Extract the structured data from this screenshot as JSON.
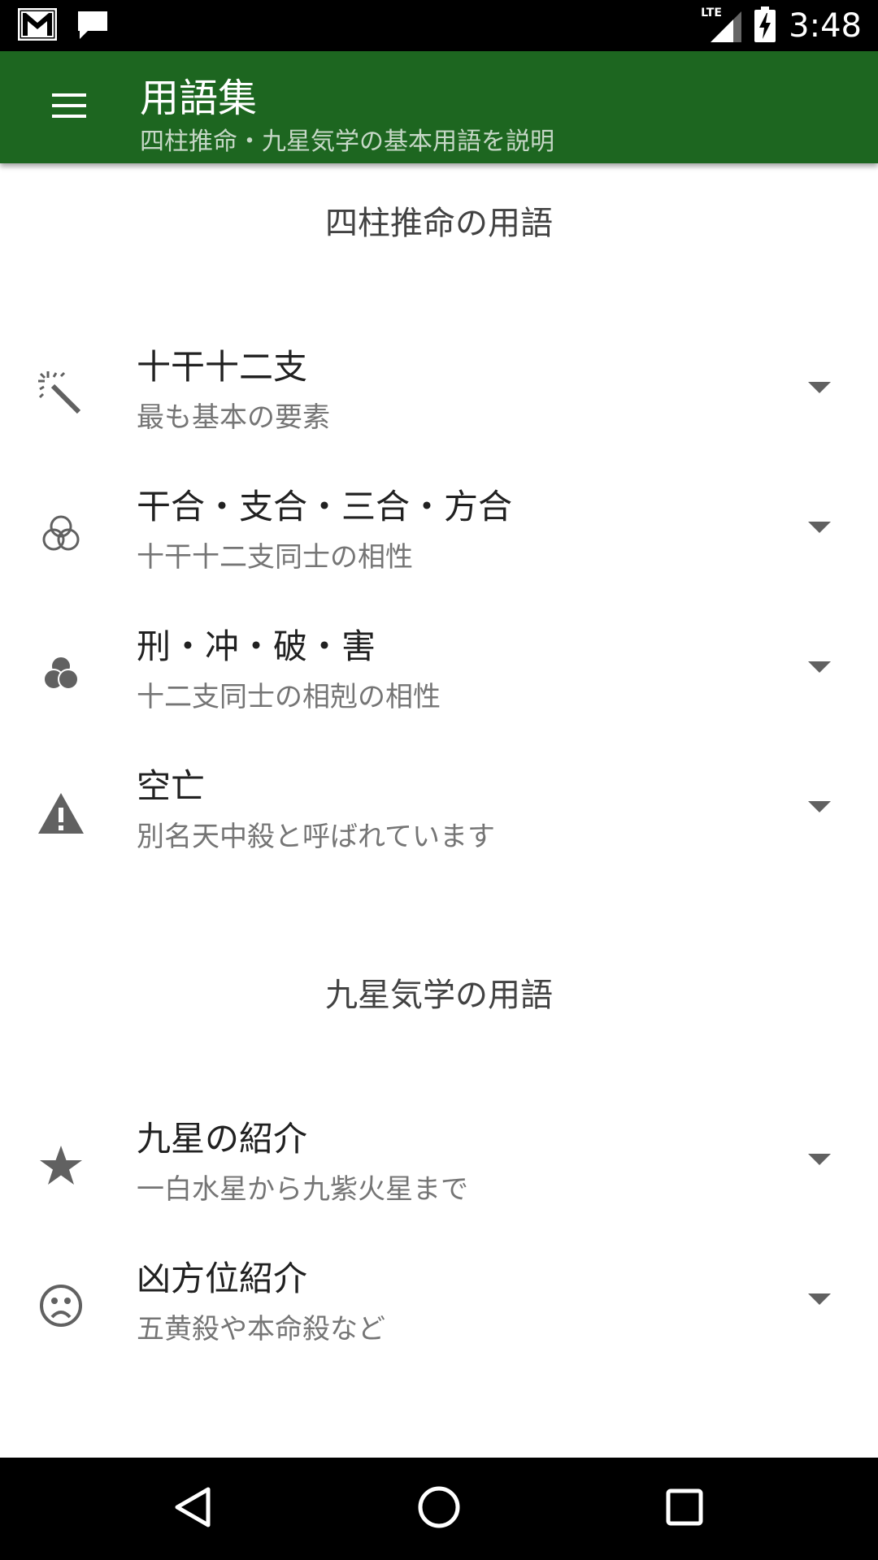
{
  "status_bar": {
    "time": "3:48",
    "network_label": "LTE",
    "icons": [
      "gmail-icon",
      "message-icon",
      "lte-signal-icon",
      "battery-charging-icon"
    ]
  },
  "app_bar": {
    "title": "用語集",
    "subtitle": "四柱推命・九星気学の基本用語を説明",
    "menu_icon": "menu-icon",
    "color": "#1d6620"
  },
  "sections": [
    {
      "header": "四柱推命の用語",
      "items": [
        {
          "icon": "magic-wand-icon",
          "title": "十干十二支",
          "subtitle": "最も基本の要素"
        },
        {
          "icon": "three-circles-outline-icon",
          "title": "干合・支合・三合・方合",
          "subtitle": "十干十二支同士の相性"
        },
        {
          "icon": "three-circles-filled-icon",
          "title": "刑・冲・破・害",
          "subtitle": "十二支同士の相剋の相性"
        },
        {
          "icon": "warning-icon",
          "title": "空亡",
          "subtitle": "別名天中殺と呼ばれています"
        }
      ]
    },
    {
      "header": "九星気学の用語",
      "items": [
        {
          "icon": "star-icon",
          "title": "九星の紹介",
          "subtitle": "一白水星から九紫火星まで"
        },
        {
          "icon": "sad-face-icon",
          "title": "凶方位紹介",
          "subtitle": "五黄殺や本命殺など"
        }
      ]
    }
  ],
  "nav_bar": {
    "icons": [
      "back-icon",
      "home-icon",
      "recents-icon"
    ]
  }
}
